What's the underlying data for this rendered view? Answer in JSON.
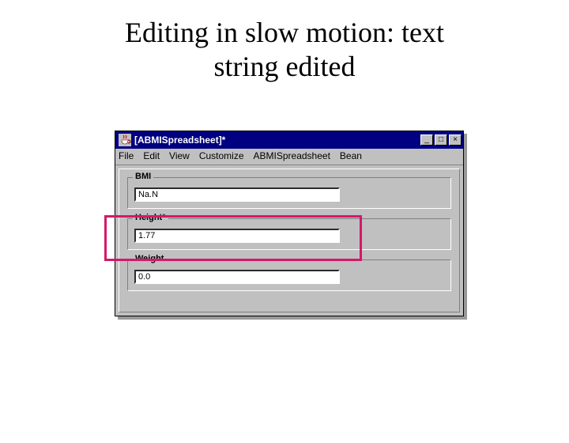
{
  "slide": {
    "title_line1": "Editing in slow motion: text",
    "title_line2": "string edited"
  },
  "window": {
    "title": "[ABMISpreadsheet]*",
    "controls": {
      "minimize": "_",
      "maximize": "□",
      "close": "×"
    }
  },
  "menu": {
    "file": "File",
    "edit": "Edit",
    "view": "View",
    "customize": "Customize",
    "abmi": "ABMISpreadsheet",
    "bean": "Bean"
  },
  "fields": {
    "bmi": {
      "label": "BMI",
      "value": "Na.N"
    },
    "height": {
      "label": "Height*",
      "value": "1.77"
    },
    "weight": {
      "label": "Weight",
      "value": "0.0"
    }
  },
  "icons": {
    "java_cup": "java-cup-icon"
  }
}
